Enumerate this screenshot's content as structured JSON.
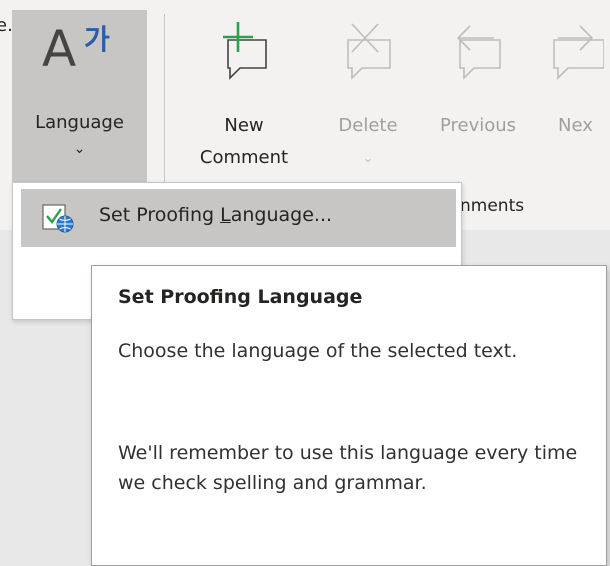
{
  "stray_text": "e.",
  "language_button": {
    "label": "Language",
    "chevron": "⌄",
    "icon": "language-icon"
  },
  "comments_group": {
    "label": "nments",
    "buttons": [
      {
        "name": "new-comment",
        "label": "New\nComment",
        "enabled": true,
        "icon": "new-comment-icon"
      },
      {
        "name": "delete",
        "label": "Delete",
        "chevron": "⌄",
        "enabled": false,
        "icon": "delete-comment-icon"
      },
      {
        "name": "previous",
        "label": "Previous",
        "enabled": false,
        "icon": "previous-comment-icon"
      },
      {
        "name": "next",
        "label": "Nex",
        "enabled": false,
        "icon": "next-comment-icon"
      }
    ]
  },
  "menu": {
    "items": [
      {
        "label_pre": "Set Proofing ",
        "label_access": "L",
        "label_post": "anguage...",
        "icon": "set-proofing-language-icon"
      }
    ]
  },
  "tooltip": {
    "title": "Set Proofing Language",
    "paragraph1": "Choose the language of the selected text.",
    "paragraph2": "We'll remember to use this language every time we check spelling and grammar."
  },
  "colors": {
    "accent_green": "#2e9e4f",
    "hangul_blue": "#2b5fa8",
    "pressed_gray": "#c8c6c4"
  }
}
